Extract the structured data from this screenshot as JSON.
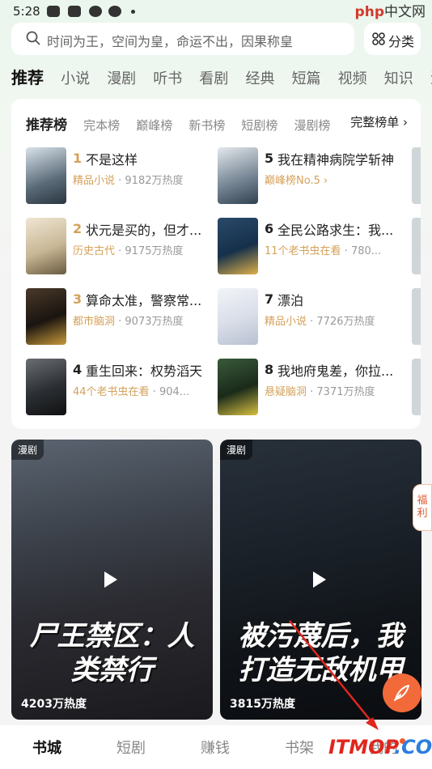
{
  "status": {
    "time": "5:28"
  },
  "watermark_top": {
    "brand": "php",
    "suffix": "中文网"
  },
  "search": {
    "placeholder": "时间为王，空间为皇，命运不出，因果称皇"
  },
  "category_button": {
    "label": "分类"
  },
  "top_tabs": [
    "推荐",
    "小说",
    "漫剧",
    "听书",
    "看剧",
    "经典",
    "短篇",
    "视频",
    "知识",
    "漫"
  ],
  "ranking": {
    "subtabs": [
      "推荐榜",
      "完本榜",
      "巅峰榜",
      "新书榜",
      "短剧榜",
      "漫剧榜"
    ],
    "full_list": "完整榜单 ›",
    "books": [
      {
        "rank": "1",
        "title": "不是这样",
        "tag": "精品小说",
        "pop": " · 9182万热度"
      },
      {
        "rank": "2",
        "title": "状元是买的，但才...",
        "tag": "历史古代",
        "pop": " · 9175万热度"
      },
      {
        "rank": "3",
        "title": "算命太准，警察常...",
        "tag": "都市脑洞",
        "pop": " · 9073万热度"
      },
      {
        "rank": "4",
        "title": "重生回来：权势滔天",
        "tag": "44个老书虫在看",
        "pop": " · 904..."
      },
      {
        "rank": "5",
        "title": "我在精神病院学斩神",
        "tag": "巅峰榜No.5 ›",
        "pop": ""
      },
      {
        "rank": "6",
        "title": "全民公路求生：我...",
        "tag": "11个老书虫在看",
        "pop": " · 780..."
      },
      {
        "rank": "7",
        "title": "漂泊",
        "tag": "精品小说",
        "pop": " · 7726万热度"
      },
      {
        "rank": "8",
        "title": "我地府鬼差，你拉...",
        "tag": "悬疑脑洞",
        "pop": " · 7371万热度"
      }
    ]
  },
  "videos": [
    {
      "badge": "漫剧",
      "art_title": "尸王禁区：人类禁行",
      "popularity": "4203万热度"
    },
    {
      "badge": "漫剧",
      "art_title": "被污蔑后，我打造无敌机甲",
      "popularity": "3815万热度"
    }
  ],
  "welfare": {
    "label": "福利"
  },
  "bottom_nav": [
    "书城",
    "短剧",
    "赚钱",
    "书架",
    "我的"
  ],
  "watermark_bottom": {
    "brand": "ITMOP",
    "suffix": ".COM"
  },
  "colors": {
    "accent": "#f26a3a",
    "rank_gold": "#d4a15a",
    "text": "#222222"
  }
}
